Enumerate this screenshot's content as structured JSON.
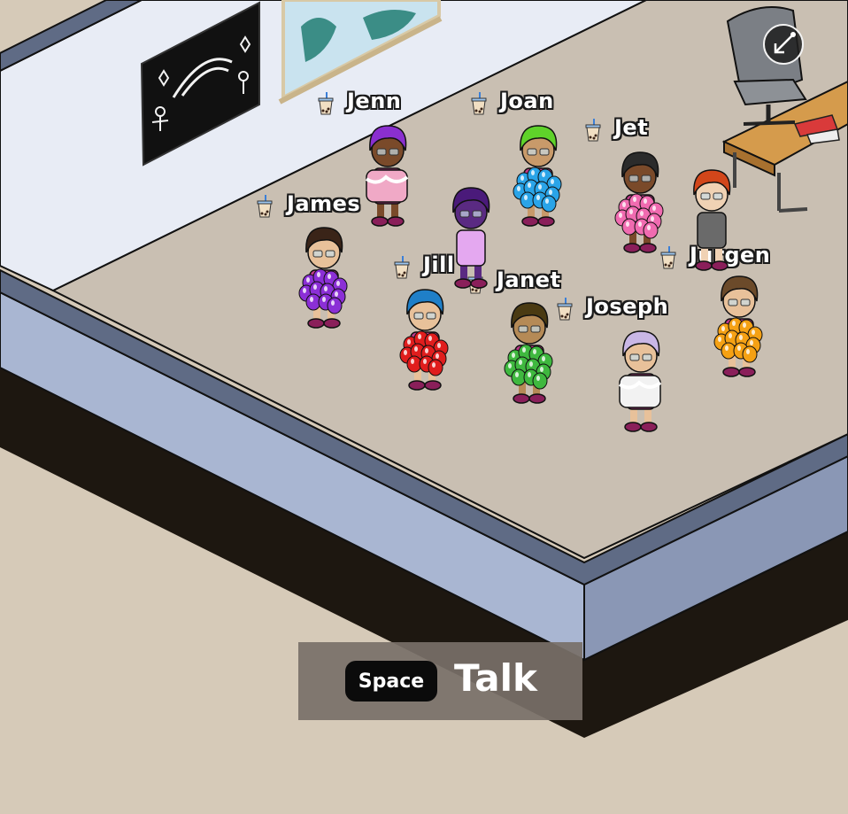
{
  "players": [
    {
      "name": "Jenn",
      "hair": "#8a2fcf",
      "skin": "#7a4a2a",
      "shirt": "#c0398a",
      "balloon": "#f0a9c6",
      "balloon_style": "cake"
    },
    {
      "name": "Joan",
      "hair": "#5fd22a",
      "skin": "#c89a6a",
      "shirt": "#c0398a",
      "balloon": "#2aa4e8"
    },
    {
      "name": "Jet",
      "hair": "#2b2b2b",
      "skin": "#7a4a2a",
      "shirt": "#c0398a",
      "balloon": "#f06bb0"
    },
    {
      "name": "James",
      "hair": "#3a2418",
      "skin": "#e8c19a",
      "shirt": "#c0398a",
      "balloon": "#8b2fd6"
    },
    {
      "name": "Jill",
      "hair": "#1f7fc8",
      "skin": "#e8c19a",
      "shirt": "#c0398a",
      "balloon": "#e01d1d"
    },
    {
      "name": "Janet",
      "hair": "#4a3a12",
      "skin": "#b58a56",
      "shirt": "#c0398a",
      "balloon": "#3fb83f"
    },
    {
      "name": "Joseph",
      "hair": "#c9b7e6",
      "skin": "#e8c19a",
      "shirt": "#c0398a",
      "balloon": "#f2f2f2",
      "balloon_style": "cake"
    },
    {
      "name": "Jurgen",
      "hair": "#6b4a2a",
      "skin": "#e8c19a",
      "shirt": "#c0398a",
      "balloon": "#f5a114"
    }
  ],
  "npcs": [
    {
      "hair": "#4a1a7a",
      "skin": "#5a2a82",
      "shirt": "#e4a8f0"
    },
    {
      "hair": "#d2461a",
      "skin": "#f0d2b4",
      "shirt": "#6a6a6a"
    }
  ],
  "hud": {
    "key_label": "Space",
    "action_label": "Talk"
  },
  "colors": {
    "floor": "#c9bfb2",
    "wall": "#e8ecf5",
    "ledge": "#a9b6d2",
    "ledge_shadow": "#1d1710",
    "background": "#d6cab8"
  },
  "icons": {
    "zoom": "zoom-out-arrow-icon",
    "drink": "bubble-tea-icon"
  }
}
